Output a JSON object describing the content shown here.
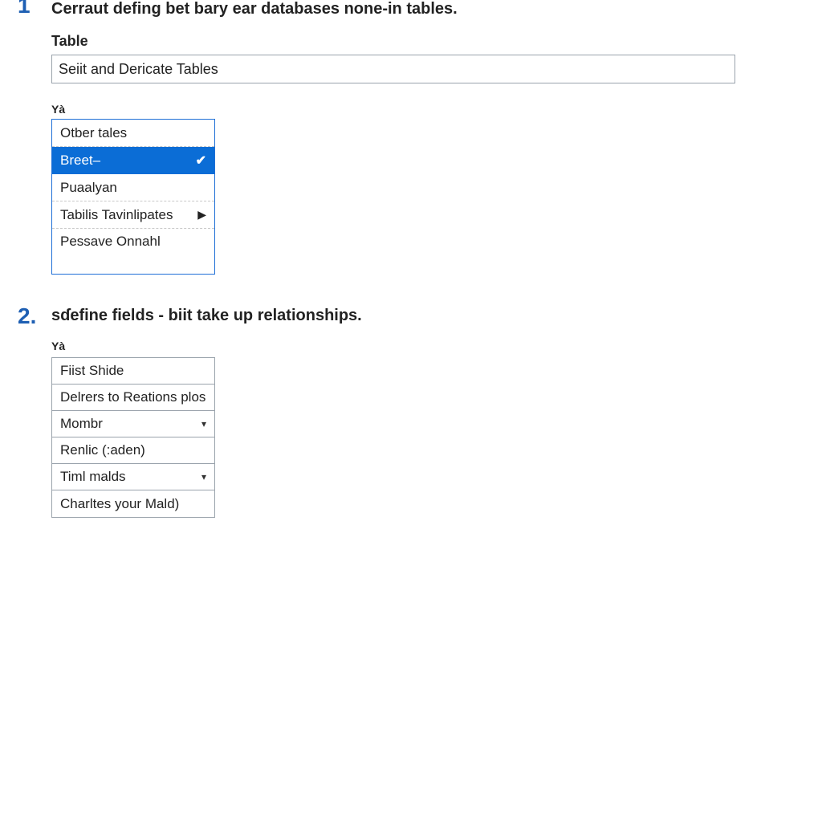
{
  "step1": {
    "number": "1",
    "title": "Cerraut defing bet bary ear databases none-in tables.",
    "field_label": "Table",
    "field_value": "Seiit and Dericate Tables",
    "mini_label": "Yà",
    "options": [
      {
        "label": "Otber tales",
        "selected": false,
        "has_submenu": false
      },
      {
        "label": "Breet–",
        "selected": true,
        "has_submenu": false
      },
      {
        "label": "Puaalyan",
        "selected": false,
        "has_submenu": false
      },
      {
        "label": "Tabilis Tavinlipates",
        "selected": false,
        "has_submenu": true
      },
      {
        "label": "Pessave Onnahl",
        "selected": false,
        "has_submenu": false
      }
    ]
  },
  "step2": {
    "number": "2.",
    "title": "sɗefine fields - biit take up relationships.",
    "mini_label": "Yà",
    "fields": [
      {
        "label": "Fiist Shide",
        "dropdown": false
      },
      {
        "label": "Delrers to Reations plos",
        "dropdown": false
      },
      {
        "label": "Mombr",
        "dropdown": true
      },
      {
        "label": "Renlic (:aden)",
        "dropdown": false
      },
      {
        "label": "Timl malds",
        "dropdown": true
      },
      {
        "label": "Charltes your Mald)",
        "dropdown": false
      }
    ]
  }
}
